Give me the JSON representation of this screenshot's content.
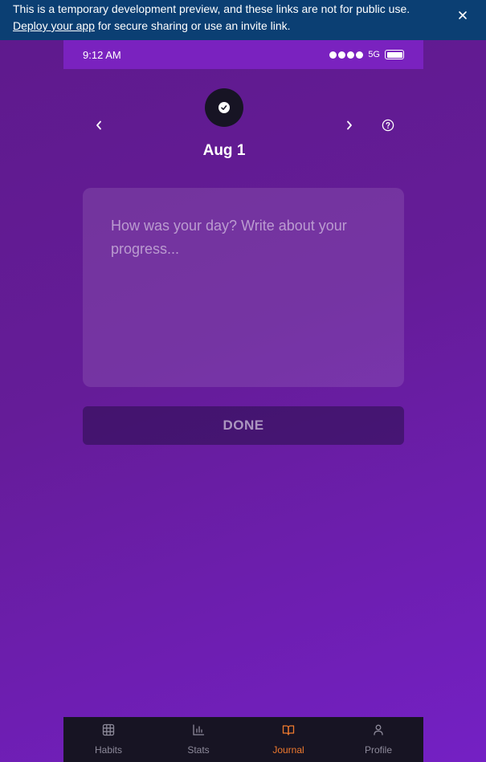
{
  "banner": {
    "message": "This is a temporary development preview, and these links are not for public use.",
    "link_text": "Deploy your app",
    "link_suffix": " for secure sharing or use an invite link."
  },
  "status_bar": {
    "time": "9:12 AM",
    "network": "5G"
  },
  "journal": {
    "date": "Aug 1",
    "placeholder": "How was your day? Write about your progress...",
    "value": "",
    "done_label": "DONE"
  },
  "tabs": [
    {
      "label": "Habits",
      "icon": "grid-icon",
      "active": false
    },
    {
      "label": "Stats",
      "icon": "bar-chart-icon",
      "active": false
    },
    {
      "label": "Journal",
      "icon": "book-icon",
      "active": true
    },
    {
      "label": "Profile",
      "icon": "user-icon",
      "active": false
    }
  ],
  "colors": {
    "banner_bg": "#0b3f73",
    "background": "#651c98",
    "tabbar_bg": "#171423",
    "active_tab": "#f07a2e"
  }
}
